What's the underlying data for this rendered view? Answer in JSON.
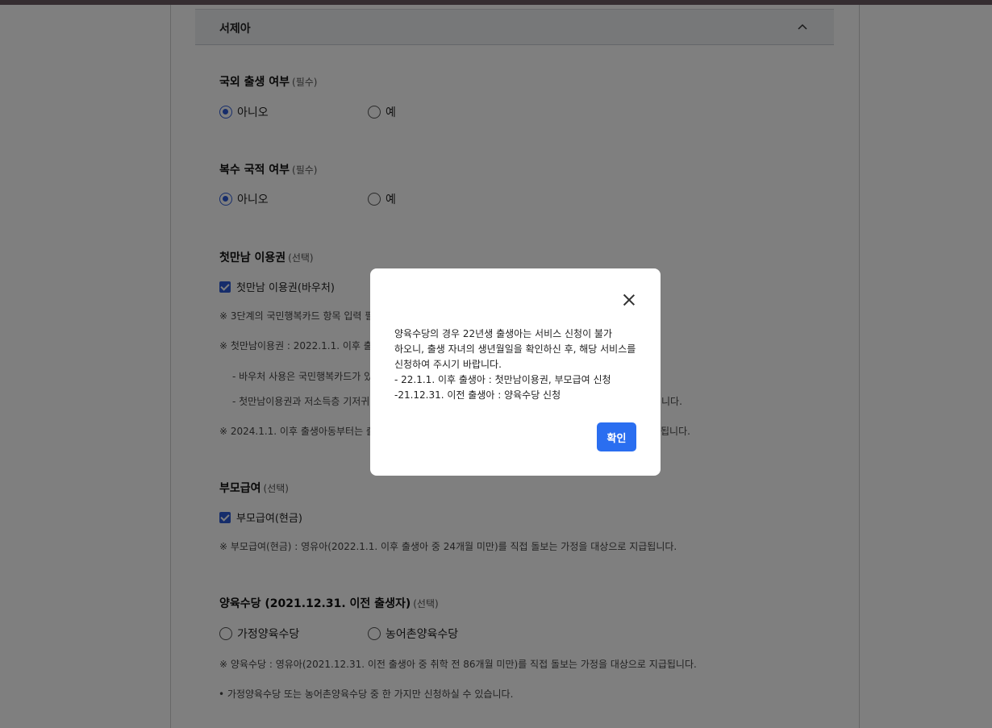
{
  "accordion": {
    "title": "서제아"
  },
  "foreign_birth": {
    "title": "국외 출생 여부",
    "req": "(필수)",
    "options": [
      "아니오",
      "예"
    ],
    "selected": "아니오"
  },
  "dual_nationality": {
    "title": "복수 국적 여부",
    "req": "(필수)",
    "options": [
      "아니오",
      "예"
    ],
    "selected": "아니오"
  },
  "voucher": {
    "title": "첫만남 이용권",
    "req": "(선택)",
    "checkbox_label": "첫만남 이용권(바우처)",
    "checked": true,
    "notes": [
      "※ 3단계의 국민행복카드 항목 입력 필",
      "※ 첫만남이용권 : 2022.1.1. 이후 출",
      "- 바우처 사용은 국민행복카드가 있",
      "- 첫만남이용권과 저소득층 기저귀",
      "니다.",
      "※ 2024.1.1. 이후 출생아동부터는 출",
      "됩니다."
    ]
  },
  "parent_benefit": {
    "title": "부모급여",
    "req": "(선택)",
    "checkbox_label": "부모급여(현금)",
    "checked": true,
    "note": "※ 부모급여(현금) : 영유아(2022.1.1. 이후 출생아 중 24개월 미만)를 직접 돌보는 가정을 대상으로 지급됩니다."
  },
  "childcare_allowance": {
    "title": "양육수당 (2021.12.31. 이전 출생자)",
    "req": "(선택)",
    "options": [
      "가정양육수당",
      "농어촌양육수당"
    ],
    "note1": "※ 양육수당 : 영유아(2021.12.31. 이전 출생아 중 취학 전 86개월 미만)를 직접 돌보는 가정을 대상으로 지급됩니다.",
    "note2": "• 가정양육수당 또는 농어촌양육수당 중 한 가지만 신청하실 수 있습니다."
  },
  "modal": {
    "message_line1": "양육수당의 경우 22년생 출생아는 서비스 신청이 불가 하오니, 출생 자녀의 생년월일을 확인하신 후, 해당 서비스를 신청하여 주시기 바랍니다.",
    "message_line2": "- 22.1.1. 이후 출생아 : 첫만남이용권, 부모급여 신청",
    "message_line3": "-21.12.31. 이전 출생아 : 양육수당 신청",
    "confirm_label": "확인",
    "close_icon": "close-icon"
  },
  "colors": {
    "accent": "#2d5bd6",
    "button": "#2a6ef0",
    "overlay": "rgba(0,0,0,0.5)"
  }
}
